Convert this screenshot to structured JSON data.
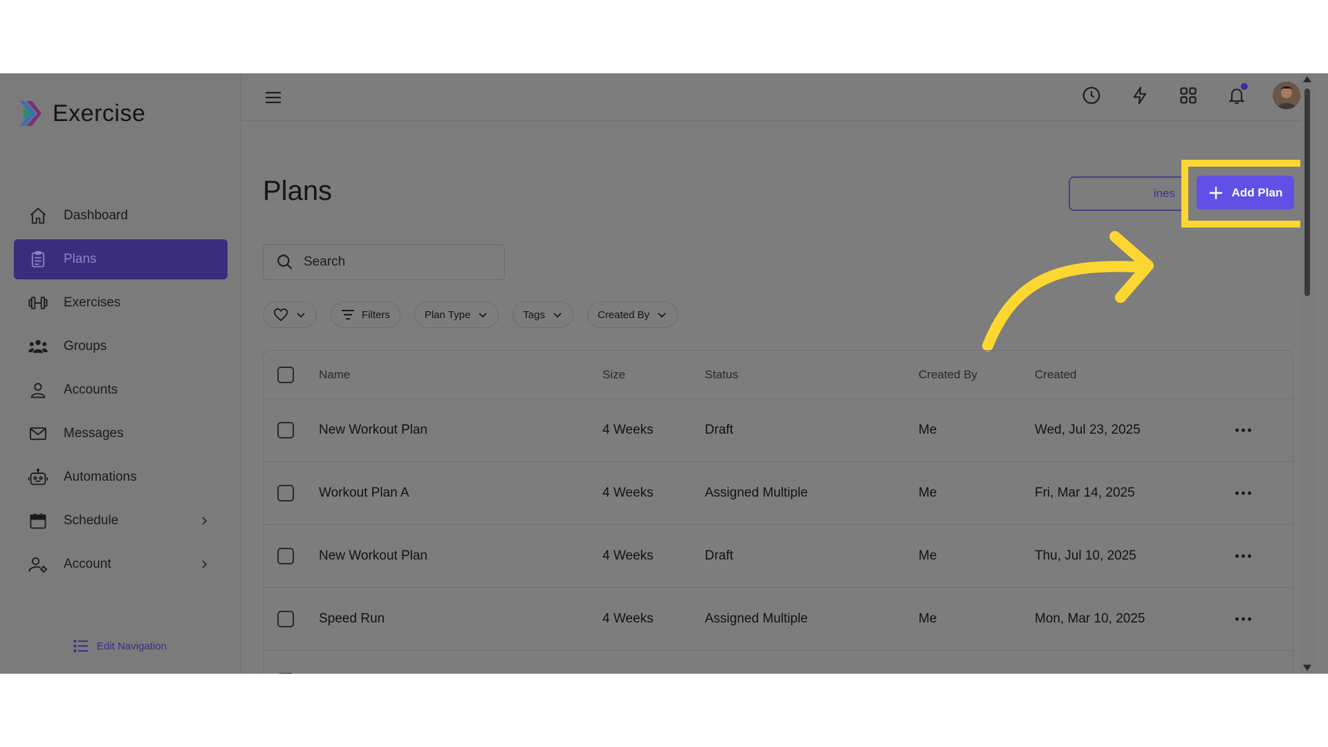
{
  "brand": {
    "name": "Exercise"
  },
  "sidebar": {
    "items": [
      {
        "label": "Dashboard",
        "icon": "home-icon"
      },
      {
        "label": "Plans",
        "icon": "clipboard-icon",
        "active": true
      },
      {
        "label": "Exercises",
        "icon": "dumbbell-icon"
      },
      {
        "label": "Groups",
        "icon": "users-icon"
      },
      {
        "label": "Accounts",
        "icon": "user-icon"
      },
      {
        "label": "Messages",
        "icon": "mail-icon"
      },
      {
        "label": "Automations",
        "icon": "robot-icon"
      },
      {
        "label": "Schedule",
        "icon": "calendar-icon",
        "has_submenu": true
      },
      {
        "label": "Account",
        "icon": "user-gear-icon",
        "has_submenu": true
      }
    ],
    "edit_navigation": "Edit Navigation"
  },
  "header": {
    "icons": [
      "history-icon",
      "lightning-icon",
      "apps-grid-icon",
      "bell-icon",
      "avatar"
    ]
  },
  "page": {
    "title": "Plans",
    "secondary_button": "ines",
    "add_button": "Add Plan",
    "search_placeholder": "Search"
  },
  "filters": {
    "filters_label": "Filters",
    "plan_type": "Plan Type",
    "tags": "Tags",
    "created_by": "Created By"
  },
  "table": {
    "columns": [
      "Name",
      "Size",
      "Status",
      "Created By",
      "Created"
    ],
    "rows": [
      {
        "name": "New Workout Plan",
        "size": "4 Weeks",
        "status": "Draft",
        "created_by": "Me",
        "created": "Wed, Jul 23, 2025"
      },
      {
        "name": "Workout Plan A",
        "size": "4 Weeks",
        "status": "Assigned Multiple",
        "created_by": "Me",
        "created": "Fri, Mar 14, 2025"
      },
      {
        "name": "New Workout Plan",
        "size": "4 Weeks",
        "status": "Draft",
        "created_by": "Me",
        "created": "Thu, Jul 10, 2025"
      },
      {
        "name": "Speed Run",
        "size": "4 Weeks",
        "status": "Assigned Multiple",
        "created_by": "Me",
        "created": "Mon, Mar 10, 2025"
      }
    ]
  },
  "colors": {
    "accent": "#6150e6",
    "highlight": "#fcd731",
    "active_nav": "#3b2d7e"
  }
}
